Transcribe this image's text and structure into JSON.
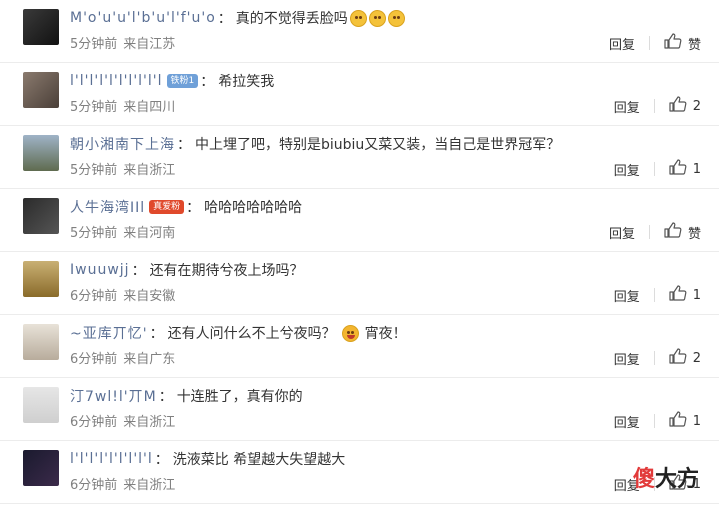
{
  "colors": {
    "username": "#5a6f94",
    "meta": "#808080",
    "text": "#333333"
  },
  "comments": [
    {
      "username": "M'o'u'u'l'b'u'l'f'u'o",
      "text": "真的不觉得丢脸吗",
      "emoji_count": 3,
      "emoji": "smiling-face-icon",
      "time": "5分钟前",
      "location": "来自江苏",
      "reply_label": "回复",
      "like_label": "赞"
    },
    {
      "username": "l'l'l'l'l'l'l'l'l'l",
      "badge": "铁粉1",
      "text": "希拉笑我",
      "time": "5分钟前",
      "location": "来自四川",
      "reply_label": "回复",
      "like_label": "2"
    },
    {
      "username": "朝小湘南下上海",
      "text": "中上埋了吧，特别是biubiu又菜又装，当自己是世界冠军？",
      "time": "5分钟前",
      "location": "来自浙江",
      "reply_label": "回复",
      "like_label": "1"
    },
    {
      "username": "人牛海湾IIl",
      "badge": "真爱粉",
      "text": "哈哈哈哈哈哈哈",
      "time": "5分钟前",
      "location": "来自河南",
      "reply_label": "回复",
      "like_label": "赞"
    },
    {
      "username": "Iwuuwjj",
      "text": "还有在期待兮夜上场吗？",
      "time": "6分钟前",
      "location": "来自安徽",
      "reply_label": "回复",
      "like_label": "1"
    },
    {
      "username": "~亚库丌忆'",
      "text": "还有人问什么不上兮夜吗？",
      "emoji": "laughing-face-icon",
      "text_after": "宵夜！",
      "time": "6分钟前",
      "location": "来自广东",
      "reply_label": "回复",
      "like_label": "2"
    },
    {
      "username": "汀7wl!l'丌M",
      "text": "十连胜了，真有你的",
      "time": "6分钟前",
      "location": "来自浙江",
      "reply_label": "回复",
      "like_label": "1"
    },
    {
      "username": "l'l'l'l'l'l'l'l'l",
      "text": "洗液菜比 希望越大失望越大",
      "time": "6分钟前",
      "location": "来自浙江",
      "reply_label": "回复",
      "like_label": "1"
    }
  ],
  "watermark": {
    "part_a": "傻",
    "part_b": "大方"
  }
}
